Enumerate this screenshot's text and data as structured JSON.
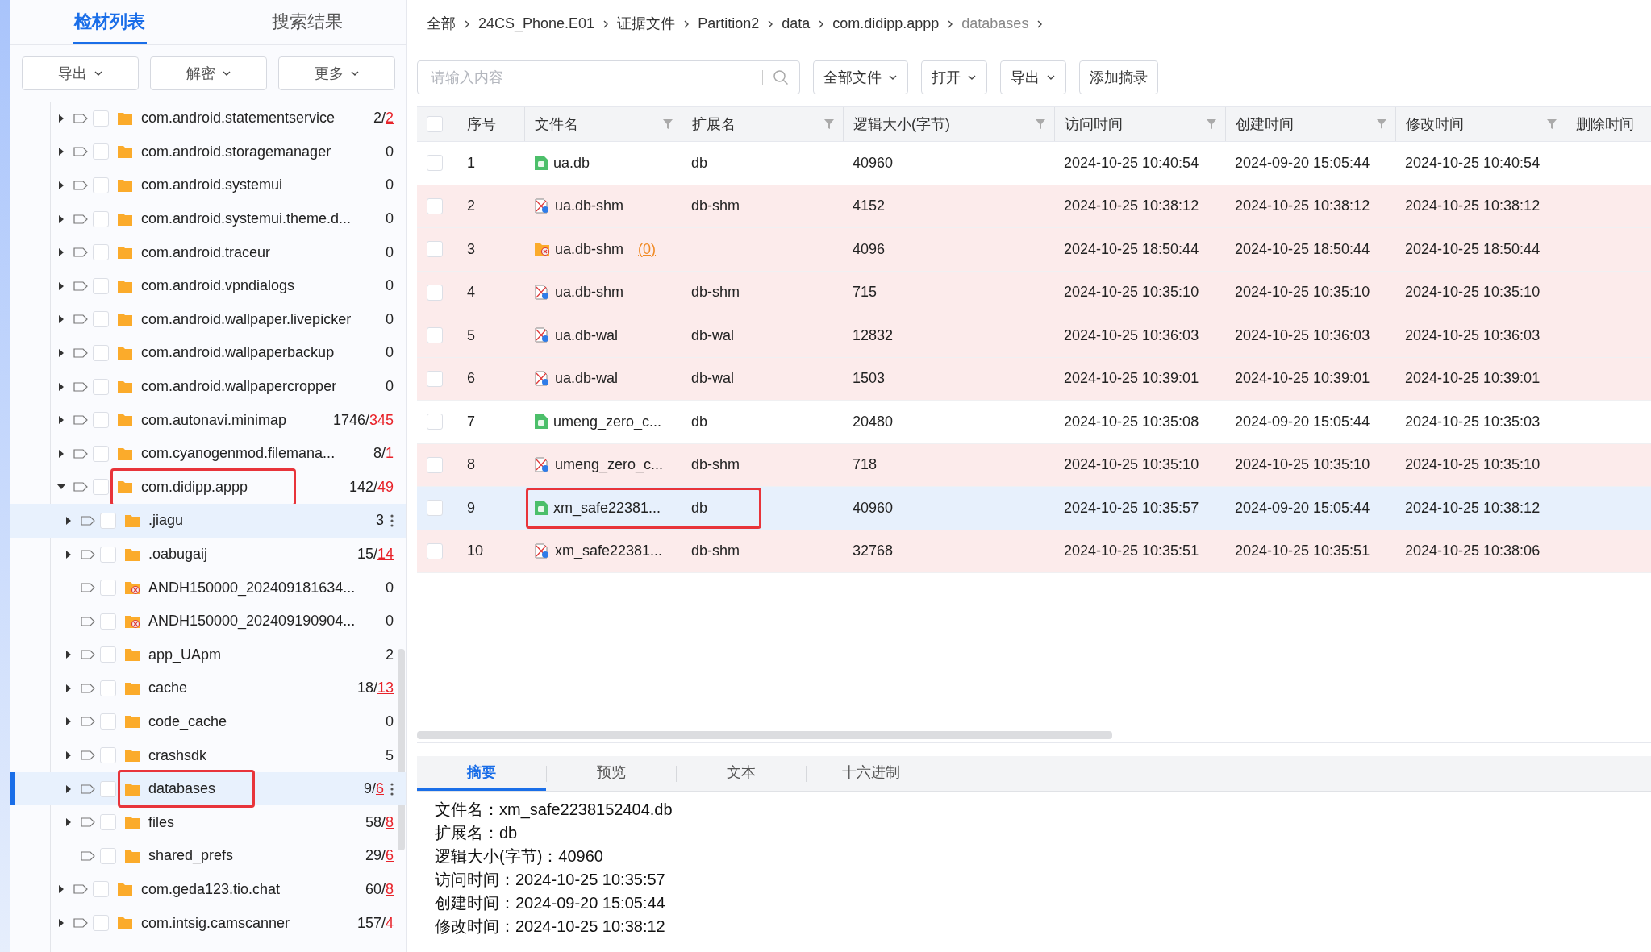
{
  "left_tabs": [
    {
      "label": "检材列表",
      "selected": true
    },
    {
      "label": "搜索结果",
      "selected": false
    }
  ],
  "left_buttons": [
    "导出",
    "解密",
    "更多"
  ],
  "tree": [
    {
      "name": "com.android.statementservice",
      "count": "2/",
      "flagged": "2",
      "kind": "folder",
      "expanded": false,
      "expandable": true,
      "checked": false,
      "selected": false,
      "hovered": false,
      "boxed": false
    },
    {
      "name": "com.android.storagemanager",
      "count": "0",
      "kind": "folder",
      "expanded": false,
      "expandable": true,
      "checked": false,
      "selected": false,
      "hovered": false,
      "boxed": false
    },
    {
      "name": "com.android.systemui",
      "count": "0",
      "kind": "folder",
      "expanded": false,
      "expandable": true,
      "checked": false,
      "selected": false,
      "hovered": false,
      "boxed": false
    },
    {
      "name": "com.android.systemui.theme.d...",
      "count": "0",
      "kind": "folder",
      "expanded": false,
      "expandable": true,
      "checked": false,
      "selected": false,
      "hovered": false,
      "boxed": false
    },
    {
      "name": "com.android.traceur",
      "count": "0",
      "kind": "folder",
      "expanded": false,
      "expandable": true,
      "checked": false,
      "selected": false,
      "hovered": false,
      "boxed": false
    },
    {
      "name": "com.android.vpndialogs",
      "count": "0",
      "kind": "folder",
      "expanded": false,
      "expandable": true,
      "checked": false,
      "selected": false,
      "hovered": false,
      "boxed": false
    },
    {
      "name": "com.android.wallpaper.livepicker",
      "count": "0",
      "kind": "folder",
      "expanded": false,
      "expandable": true,
      "checked": false,
      "selected": false,
      "hovered": false,
      "boxed": false
    },
    {
      "name": "com.android.wallpaperbackup",
      "count": "0",
      "kind": "folder",
      "expanded": false,
      "expandable": true,
      "checked": false,
      "selected": false,
      "hovered": false,
      "boxed": false
    },
    {
      "name": "com.android.wallpapercropper",
      "count": "0",
      "kind": "folder",
      "expanded": false,
      "expandable": true,
      "checked": false,
      "selected": false,
      "hovered": false,
      "boxed": false
    },
    {
      "name": "com.autonavi.minimap",
      "count": "1746/",
      "flagged": "345",
      "kind": "folder",
      "expanded": false,
      "expandable": true,
      "checked": false,
      "selected": false,
      "hovered": false,
      "boxed": false
    },
    {
      "name": "com.cyanogenmod.filemana...",
      "count": "8/",
      "flagged": "1",
      "kind": "folder",
      "expanded": false,
      "expandable": true,
      "checked": false,
      "selected": false,
      "hovered": false,
      "boxed": false
    },
    {
      "name": "com.didipp.appp",
      "count": "142/",
      "flagged": "49",
      "kind": "folder",
      "expanded": true,
      "expandable": true,
      "checked": false,
      "selected": false,
      "hovered": false,
      "boxed": true,
      "children": [
        {
          "name": ".jiagu",
          "count": "3",
          "kind": "folder",
          "expanded": false,
          "expandable": true,
          "checked": false,
          "selected": false,
          "hovered": true,
          "boxed": false
        },
        {
          "name": ".oabugaij",
          "count": "15/",
          "flagged": "14",
          "kind": "folder",
          "expanded": false,
          "expandable": true,
          "checked": false,
          "selected": false,
          "hovered": false,
          "boxed": false
        },
        {
          "name": "ANDH150000_202409181634...",
          "count": "0",
          "kind": "deleted-folder",
          "expandable": false,
          "checked": false,
          "selected": false,
          "hovered": false,
          "boxed": false
        },
        {
          "name": "ANDH150000_202409190904...",
          "count": "0",
          "kind": "deleted-folder",
          "expandable": false,
          "checked": false,
          "selected": false,
          "hovered": false,
          "boxed": false
        },
        {
          "name": "app_UApm",
          "count": "2",
          "kind": "folder",
          "expanded": false,
          "expandable": true,
          "checked": false,
          "selected": false,
          "hovered": false,
          "boxed": false
        },
        {
          "name": "cache",
          "count": "18/",
          "flagged": "13",
          "kind": "folder",
          "expanded": false,
          "expandable": true,
          "checked": false,
          "selected": false,
          "hovered": false,
          "boxed": false
        },
        {
          "name": "code_cache",
          "count": "0",
          "kind": "folder",
          "expanded": false,
          "expandable": true,
          "checked": false,
          "selected": false,
          "hovered": false,
          "boxed": false
        },
        {
          "name": "crashsdk",
          "count": "5",
          "kind": "folder",
          "expanded": false,
          "expandable": true,
          "checked": false,
          "selected": false,
          "hovered": false,
          "boxed": false
        },
        {
          "name": "databases",
          "count": "9/",
          "flagged": "6",
          "kind": "folder",
          "expanded": false,
          "expandable": true,
          "checked": false,
          "selected": true,
          "hovered": false,
          "boxed": true
        },
        {
          "name": "files",
          "count": "58/",
          "flagged": "8",
          "kind": "folder",
          "expanded": false,
          "expandable": true,
          "checked": false,
          "selected": false,
          "hovered": false,
          "boxed": false
        },
        {
          "name": "shared_prefs",
          "count": "29/",
          "flagged": "6",
          "kind": "folder",
          "expandable": false,
          "checked": false,
          "selected": false,
          "hovered": false,
          "boxed": false
        }
      ]
    },
    {
      "name": "com.geda123.tio.chat",
      "count": "60/",
      "flagged": "8",
      "kind": "folder",
      "expanded": false,
      "expandable": true,
      "checked": false,
      "selected": false,
      "hovered": false,
      "boxed": false
    },
    {
      "name": "com.intsig.camscanner",
      "count": "157/",
      "flagged": "4",
      "kind": "folder",
      "expanded": false,
      "expandable": true,
      "checked": false,
      "selected": false,
      "hovered": false,
      "boxed": false
    }
  ],
  "breadcrumb": [
    "全部",
    "24CS_Phone.E01",
    "证据文件",
    "Partition2",
    "data",
    "com.didipp.appp",
    "databases"
  ],
  "search": {
    "placeholder": "请输入内容"
  },
  "toolbar": [
    "全部文件",
    "打开",
    "导出",
    "添加摘录"
  ],
  "all_checked": false,
  "columns": [
    "序号",
    "文件名",
    "扩展名",
    "逻辑大小(字节)",
    "访问时间",
    "创建时间",
    "修改时间",
    "删除时间"
  ],
  "rows": [
    {
      "no": "1",
      "name": "ua.db",
      "ext": "db",
      "size": "40960",
      "access": "2024-10-25 10:40:54",
      "created": "2024-09-20 15:05:44",
      "modified": "2024-10-25 10:40:54",
      "kind": "db",
      "checked": false,
      "deleted": false,
      "selected": false,
      "boxed": false
    },
    {
      "no": "2",
      "name": "ua.db-shm",
      "ext": "db-shm",
      "size": "4152",
      "access": "2024-10-25 10:38:12",
      "created": "2024-10-25 10:38:12",
      "modified": "2024-10-25 10:38:12",
      "kind": "deleted-file",
      "checked": false,
      "deleted": true,
      "selected": false,
      "boxed": false
    },
    {
      "no": "3",
      "name": "ua.db-shm",
      "link": "(0)",
      "size": "4096",
      "access": "2024-10-25 18:50:44",
      "created": "2024-10-25 18:50:44",
      "modified": "2024-10-25 18:50:44",
      "kind": "deleted-folder",
      "checked": false,
      "deleted": true,
      "selected": false,
      "boxed": false
    },
    {
      "no": "4",
      "name": "ua.db-shm",
      "ext": "db-shm",
      "size": "715",
      "access": "2024-10-25 10:35:10",
      "created": "2024-10-25 10:35:10",
      "modified": "2024-10-25 10:35:10",
      "kind": "deleted-file",
      "checked": false,
      "deleted": true,
      "selected": false,
      "boxed": false
    },
    {
      "no": "5",
      "name": "ua.db-wal",
      "ext": "db-wal",
      "size": "12832",
      "access": "2024-10-25 10:36:03",
      "created": "2024-10-25 10:36:03",
      "modified": "2024-10-25 10:36:03",
      "kind": "deleted-file",
      "checked": false,
      "deleted": true,
      "selected": false,
      "boxed": false
    },
    {
      "no": "6",
      "name": "ua.db-wal",
      "ext": "db-wal",
      "size": "1503",
      "access": "2024-10-25 10:39:01",
      "created": "2024-10-25 10:39:01",
      "modified": "2024-10-25 10:39:01",
      "kind": "deleted-file",
      "checked": false,
      "deleted": true,
      "selected": false,
      "boxed": false
    },
    {
      "no": "7",
      "name": "umeng_zero_c...",
      "ext": "db",
      "size": "20480",
      "access": "2024-10-25 10:35:08",
      "created": "2024-09-20 15:05:44",
      "modified": "2024-10-25 10:35:03",
      "kind": "db",
      "checked": false,
      "deleted": false,
      "selected": false,
      "boxed": false
    },
    {
      "no": "8",
      "name": "umeng_zero_c...",
      "ext": "db-shm",
      "size": "718",
      "access": "2024-10-25 10:35:10",
      "created": "2024-10-25 10:35:10",
      "modified": "2024-10-25 10:35:10",
      "kind": "deleted-file",
      "checked": false,
      "deleted": true,
      "selected": false,
      "boxed": false
    },
    {
      "no": "9",
      "name": "xm_safe22381...",
      "ext": "db",
      "size": "40960",
      "access": "2024-10-25 10:35:57",
      "created": "2024-09-20 15:05:44",
      "modified": "2024-10-25 10:38:12",
      "kind": "db",
      "checked": false,
      "deleted": false,
      "selected": true,
      "boxed": true
    },
    {
      "no": "10",
      "name": "xm_safe22381...",
      "ext": "db-shm",
      "size": "32768",
      "access": "2024-10-25 10:35:51",
      "created": "2024-10-25 10:35:51",
      "modified": "2024-10-25 10:38:06",
      "kind": "deleted-file",
      "checked": false,
      "deleted": true,
      "selected": false,
      "boxed": false
    }
  ],
  "detail_tabs": [
    {
      "label": "摘要",
      "selected": true
    },
    {
      "label": "预览",
      "selected": false
    },
    {
      "label": "文本",
      "selected": false
    },
    {
      "label": "十六进制",
      "selected": false
    }
  ],
  "summary": [
    "文件名：xm_safe2238152404.db",
    "扩展名：db",
    "逻辑大小(字节)：40960",
    "访问时间：2024-10-25 10:35:57",
    "创建时间：2024-09-20 15:05:44",
    "修改时间：2024-10-25 10:38:12"
  ]
}
